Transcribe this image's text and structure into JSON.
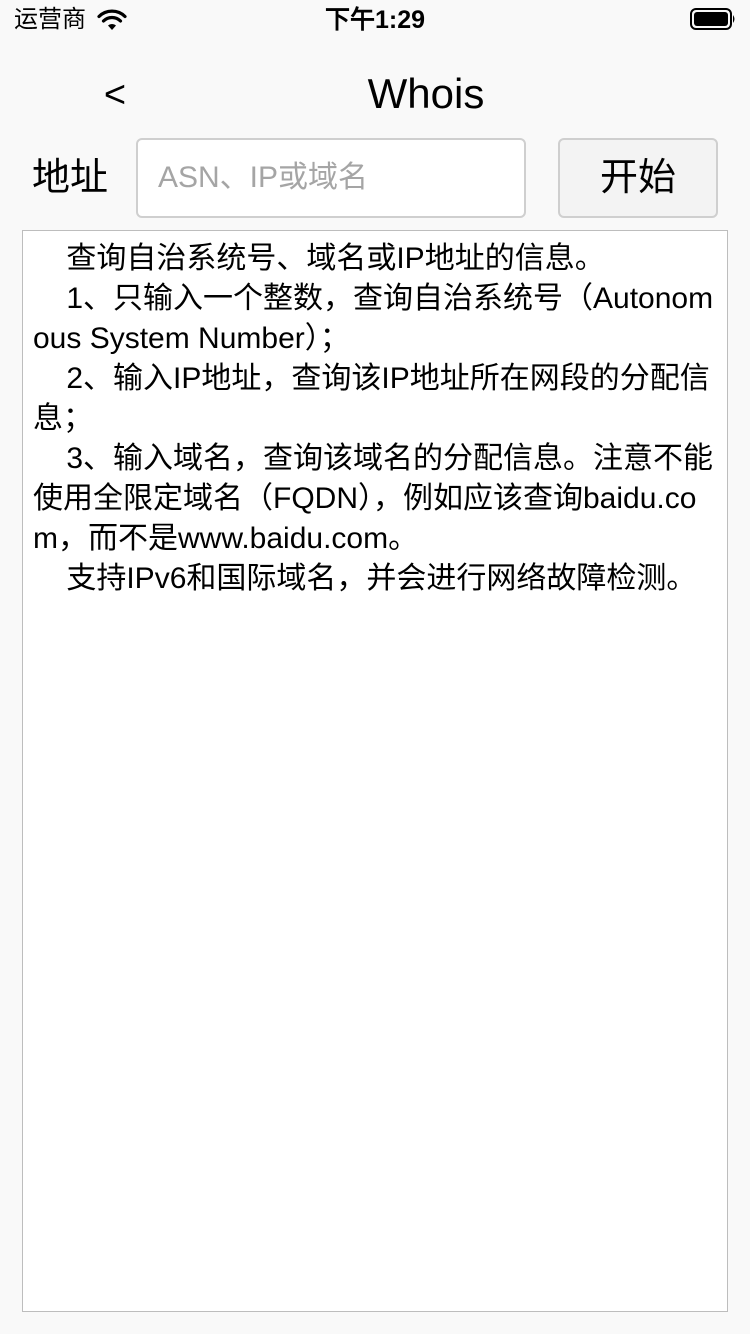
{
  "status_bar": {
    "carrier": "运营商",
    "time": "下午1:29",
    "wifi_icon": "wifi-icon",
    "battery_icon": "battery-icon"
  },
  "nav": {
    "back_label": "<",
    "title": "Whois"
  },
  "form": {
    "address_label": "地址",
    "address_placeholder": "ASN、IP或域名",
    "address_value": "",
    "start_label": "开始"
  },
  "result": {
    "text": "    查询自治系统号、域名或IP地址的信息。\n    1、只输入一个整数，查询自治系统号（Autonomous System Number）；\n    2、输入IP地址，查询该IP地址所在网段的分配信息；\n    3、输入域名，查询该域名的分配信息。注意不能使用全限定域名（FQDN），例如应该查询baidu.com，而不是www.baidu.com。\n    支持IPv6和国际域名，并会进行网络故障检测。"
  }
}
